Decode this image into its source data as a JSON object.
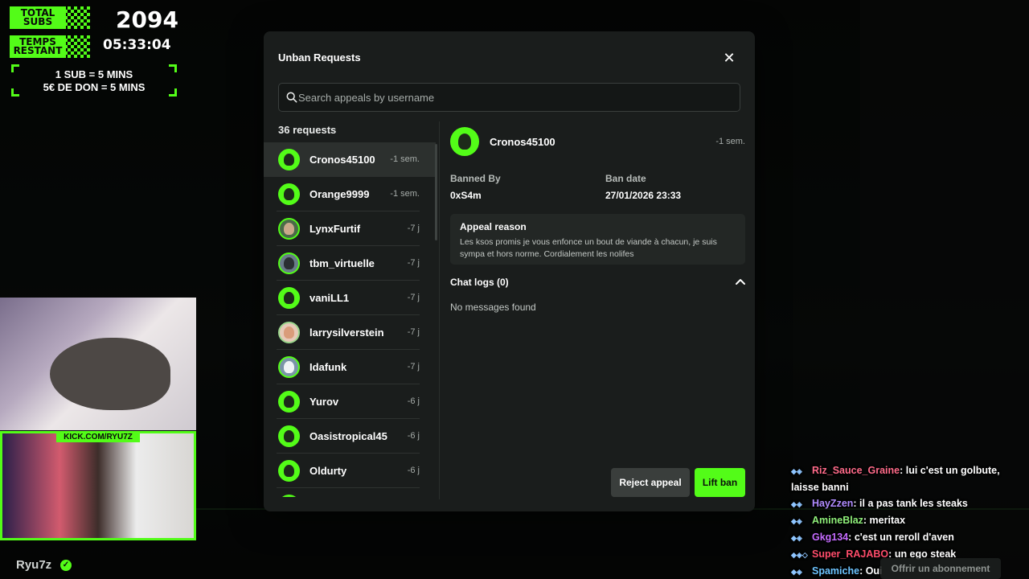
{
  "overlay": {
    "total_subs_label": "TOTAL SUBS",
    "subs_count": "2094",
    "time_left_label": "TEMPS RESTANT",
    "time_left": "05:33:04",
    "rule_sub": "1 SUB = 5 MINS",
    "rule_don": "5€ DE DON = 5 MINS",
    "kick_url": "KICK.COM/RYU7Z",
    "streamer_name": "Ryu7z",
    "accent_color": "#53fc18"
  },
  "modal": {
    "title": "Unban Requests",
    "close_icon": "close-icon",
    "search_placeholder": "Search appeals by username",
    "search_value": "",
    "requests_count": "36 requests",
    "requests": [
      {
        "username": "Cronos45100",
        "time": "-1 sem."
      },
      {
        "username": "Orange9999",
        "time": "-1 sem."
      },
      {
        "username": "LynxFurtif",
        "time": "-7 j"
      },
      {
        "username": "tbm_virtuelle",
        "time": "-7 j"
      },
      {
        "username": "vaniLL1",
        "time": "-7 j"
      },
      {
        "username": "larrysilverstein",
        "time": "-7 j"
      },
      {
        "username": "Idafunk",
        "time": "-7 j"
      },
      {
        "username": "Yurov",
        "time": "-6 j"
      },
      {
        "username": "Oasistropical45",
        "time": "-6 j"
      },
      {
        "username": "Oldurty",
        "time": "-6 j"
      }
    ],
    "detail": {
      "username": "Cronos45100",
      "time": "-1 sem.",
      "banned_by_label": "Banned By",
      "banned_by": "0xS4m",
      "ban_date_label": "Ban date",
      "ban_date": "27/01/2026 23:33",
      "appeal_reason_label": "Appeal reason",
      "appeal_reason": "Les ksos promis je vous enfonce un bout de viande à chacun, je suis sympa et hors norme. Cordialement les nolifes",
      "chat_logs_label": "Chat logs (0)",
      "no_messages": "No messages found"
    },
    "reject_label": "Reject appeal",
    "lift_label": "Lift ban"
  },
  "chat": [
    {
      "user": "Riz_Sauce_Graine",
      "color": "#ff6b8a",
      "message": "lui c'est un golbute, laisse banni"
    },
    {
      "user": "HayZzen",
      "color": "#b08cff",
      "message": "il a pas tank les steaks"
    },
    {
      "user": "AmineBlaz",
      "color": "#8ff07a",
      "message": "meritax"
    },
    {
      "user": "Gkg134",
      "color": "#c56cff",
      "message": "c'est un reroll d'aven"
    },
    {
      "user": "Super_RAJABO",
      "color": "#ff4d6b",
      "message": "un ego steak"
    },
    {
      "user": "Spamiche",
      "color": "#6cc4ff",
      "message": "Oui"
    }
  ],
  "offer_label": "Offrir un abonnement"
}
